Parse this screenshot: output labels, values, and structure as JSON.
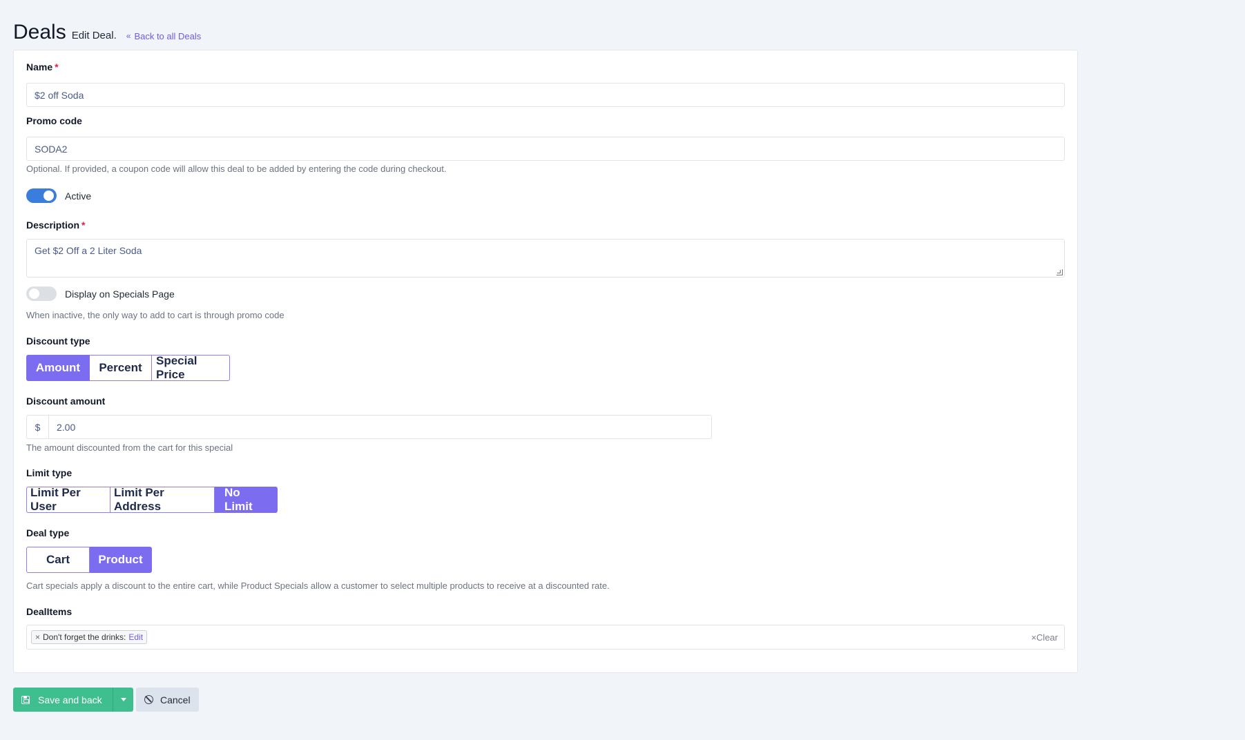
{
  "header": {
    "title": "Deals",
    "subtitle": "Edit Deal.",
    "back_link": "Back to all Deals"
  },
  "form": {
    "name": {
      "label": "Name",
      "required_mark": "*",
      "value": "$2 off Soda"
    },
    "promo_code": {
      "label": "Promo code",
      "value": "SODA2",
      "help": "Optional. If provided, a coupon code will allow this deal to be added by entering the code during checkout."
    },
    "active": {
      "label": "Active",
      "on": true
    },
    "description": {
      "label": "Description",
      "required_mark": "*",
      "value": "Get $2 Off a 2 Liter Soda"
    },
    "display_specials": {
      "label": "Display on Specials Page",
      "on": false,
      "help": "When inactive, the only way to add to cart is through promo code"
    },
    "discount_type": {
      "label": "Discount type",
      "options": [
        "Amount",
        "Percent",
        "Special Price"
      ],
      "selected": "Amount"
    },
    "discount_amount": {
      "label": "Discount amount",
      "prefix": "$",
      "value": "2.00",
      "help": "The amount discounted from the cart for this special"
    },
    "limit_type": {
      "label": "Limit type",
      "options": [
        "Limit Per User",
        "Limit Per Address",
        "No Limit"
      ],
      "selected": "No Limit"
    },
    "deal_type": {
      "label": "Deal type",
      "options": [
        "Cart",
        "Product"
      ],
      "selected": "Product",
      "help": "Cart specials apply a discount to the entire cart, while Product Specials allow a customer to select multiple products to receive at a discounted rate."
    },
    "deal_items": {
      "label": "DealItems",
      "tag_remove": "×",
      "tag_text": "Don't forget the drinks:",
      "tag_edit": "Edit",
      "clear": "×Clear"
    }
  },
  "footer": {
    "save": "Save and back",
    "cancel": "Cancel"
  },
  "colors": {
    "accent": "#7c6cf0",
    "save": "#3fbf8f",
    "toggle_on": "#3b7ddd"
  }
}
